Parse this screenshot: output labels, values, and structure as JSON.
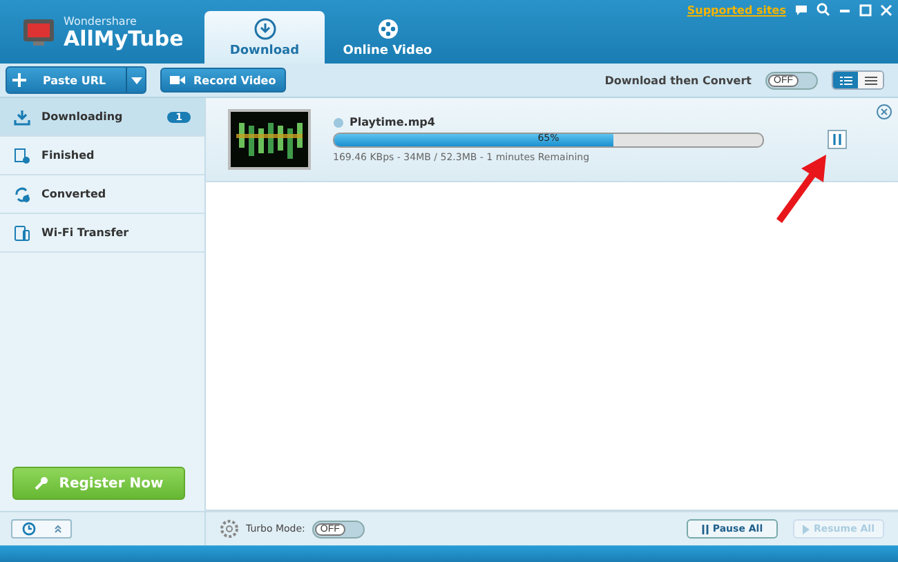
{
  "brand": {
    "company": "Wondershare",
    "product": "AllMyTube"
  },
  "tabs": [
    {
      "label": "Download",
      "selected": true
    },
    {
      "label": "Online Video",
      "selected": false
    }
  ],
  "top_link": "Supported sites",
  "toolbar": {
    "paste_url": "Paste URL",
    "record_video": "Record Video",
    "convert_label": "Download then Convert",
    "convert_toggle": {
      "label": "OFF",
      "on": false
    },
    "views": [
      {
        "kind": "thumbs",
        "selected": true
      },
      {
        "kind": "list",
        "selected": false
      }
    ]
  },
  "sidebar": [
    {
      "label": "Downloading",
      "badge": "1",
      "selected": true
    },
    {
      "label": "Finished",
      "selected": false
    },
    {
      "label": "Converted",
      "selected": false
    },
    {
      "label": "Wi-Fi Transfer",
      "selected": false
    }
  ],
  "downloads": [
    {
      "name": "Playtime.mp4",
      "level": 0.65,
      "percent": "65%",
      "status": "169.46 KBps - 34MB / 52.3MB - 1 minutes Remaining"
    }
  ],
  "register": "Register Now",
  "turbo": {
    "label": "Turbo Mode:",
    "toggle": "OFF",
    "on": false
  },
  "pause_all": {
    "label": "Pause All",
    "disabled": false
  },
  "resume_all": {
    "label": "Resume All",
    "disabled": true
  }
}
